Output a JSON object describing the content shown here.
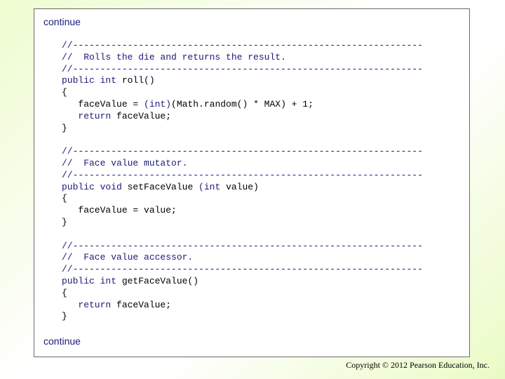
{
  "slide": {
    "continue_top": "continue",
    "continue_bottom": "continue",
    "copyright": "Copyright © 2012 Pearson Education, Inc."
  },
  "code_lines": [
    [
      {
        "t": "comment",
        "s": "//----------------------------------------------------------------"
      }
    ],
    [
      {
        "t": "comment",
        "s": "//  Rolls the die and returns the result."
      }
    ],
    [
      {
        "t": "comment",
        "s": "//----------------------------------------------------------------"
      }
    ],
    [
      {
        "t": "keyword",
        "s": "public int"
      },
      {
        "t": "text",
        "s": " roll()"
      }
    ],
    [
      {
        "t": "text",
        "s": "{"
      }
    ],
    [
      {
        "t": "text",
        "s": "   faceValue = "
      },
      {
        "t": "keyword",
        "s": "(int)"
      },
      {
        "t": "text",
        "s": "(Math.random() * MAX) + 1;"
      }
    ],
    [
      {
        "t": "text",
        "s": "   "
      },
      {
        "t": "keyword",
        "s": "return"
      },
      {
        "t": "text",
        "s": " faceValue;"
      }
    ],
    [
      {
        "t": "text",
        "s": "}"
      }
    ],
    [
      {
        "t": "text",
        "s": ""
      }
    ],
    [
      {
        "t": "comment",
        "s": "//----------------------------------------------------------------"
      }
    ],
    [
      {
        "t": "comment",
        "s": "//  Face value mutator."
      }
    ],
    [
      {
        "t": "comment",
        "s": "//----------------------------------------------------------------"
      }
    ],
    [
      {
        "t": "keyword",
        "s": "public void"
      },
      {
        "t": "text",
        "s": " setFaceValue "
      },
      {
        "t": "keyword",
        "s": "(int"
      },
      {
        "t": "text",
        "s": " value)"
      }
    ],
    [
      {
        "t": "text",
        "s": "{"
      }
    ],
    [
      {
        "t": "text",
        "s": "   faceValue = value;"
      }
    ],
    [
      {
        "t": "text",
        "s": "}"
      }
    ],
    [
      {
        "t": "text",
        "s": ""
      }
    ],
    [
      {
        "t": "comment",
        "s": "//----------------------------------------------------------------"
      }
    ],
    [
      {
        "t": "comment",
        "s": "//  Face value accessor."
      }
    ],
    [
      {
        "t": "comment",
        "s": "//----------------------------------------------------------------"
      }
    ],
    [
      {
        "t": "keyword",
        "s": "public int"
      },
      {
        "t": "text",
        "s": " getFaceValue()"
      }
    ],
    [
      {
        "t": "text",
        "s": "{"
      }
    ],
    [
      {
        "t": "text",
        "s": "   "
      },
      {
        "t": "keyword",
        "s": "return"
      },
      {
        "t": "text",
        "s": " faceValue;"
      }
    ],
    [
      {
        "t": "text",
        "s": "}"
      }
    ]
  ],
  "colors": {
    "comment": "#1a1a7a",
    "keyword": "#1a1a7a",
    "text": "#000000",
    "border": "#6a6a6a"
  }
}
